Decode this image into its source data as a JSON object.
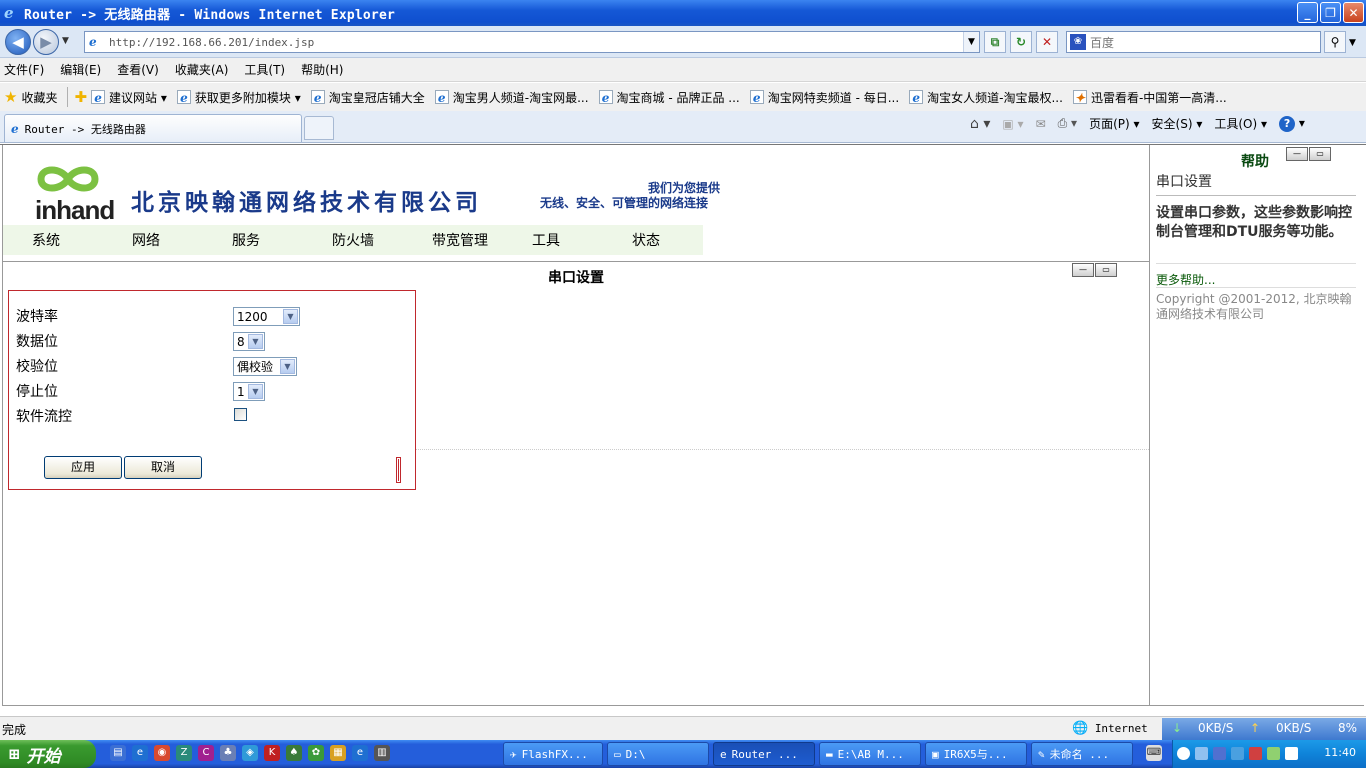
{
  "window": {
    "title": "Router -> 无线路由器 - Windows Internet Explorer",
    "minimize": "_",
    "maximize": "❐",
    "close": "✕"
  },
  "address_bar": {
    "url": "http://192.168.66.201/index.jsp",
    "search_placeholder": "百度"
  },
  "menu": [
    "文件(F)",
    "编辑(E)",
    "查看(V)",
    "收藏夹(A)",
    "工具(T)",
    "帮助(H)"
  ],
  "favorites_bar": {
    "label": "收藏夹",
    "items": [
      "建议网站 ▾",
      "获取更多附加模块 ▾",
      "淘宝皇冠店铺大全",
      "淘宝男人频道-淘宝网最...",
      "淘宝商城 - 品牌正品 ...",
      "淘宝网特卖频道 - 每日...",
      "淘宝女人频道-淘宝最权...",
      "迅雷看看-中国第一高清..."
    ]
  },
  "tab": {
    "label": "Router -> 无线路由器"
  },
  "command_bar": {
    "page": "页面(P) ▾",
    "safety": "安全(S) ▾",
    "tools": "工具(O) ▾",
    "help": "?"
  },
  "header": {
    "logo_text": "inhand",
    "company": "北京映翰通网络技术有限公司",
    "slogan_line1": "我们为您提供",
    "slogan_line2": "无线、安全、可管理的网络连接"
  },
  "nav": [
    "系统",
    "网络",
    "服务",
    "防火墙",
    "带宽管理",
    "工具",
    "状态"
  ],
  "section": {
    "title": "串口设置"
  },
  "form": {
    "rows": [
      {
        "label": "波特率",
        "value": "1200"
      },
      {
        "label": "数据位",
        "value": "8"
      },
      {
        "label": "校验位",
        "value": "偶校验"
      },
      {
        "label": "停止位",
        "value": "1"
      },
      {
        "label": "软件流控",
        "value": ""
      }
    ],
    "software_flow_control": false,
    "apply": "应用",
    "cancel": "取消"
  },
  "help": {
    "title": "帮助",
    "subtitle": "串口设置",
    "description": "设置串口参数，这些参数影响控制台管理和DTU服务等功能。",
    "more": "更多帮助...",
    "copyright": "Copyright @2001-2012, 北京映翰通网络技术有限公司"
  },
  "status_bar": {
    "status": "完成",
    "zone": "Internet",
    "down": "0KB/S",
    "up": "0KB/S",
    "cpu": "8%"
  },
  "taskbar": {
    "start": "开始",
    "tasks": [
      "FlashFX...",
      "D:\\",
      "Router ...",
      "E:\\AB M...",
      "IR6X5与...",
      "未命名 ..."
    ],
    "clock": "11:40"
  },
  "colors": {
    "form_border": "#c0282d",
    "nav_bg": "#eef7e8",
    "company_text": "#1a3a8a"
  }
}
